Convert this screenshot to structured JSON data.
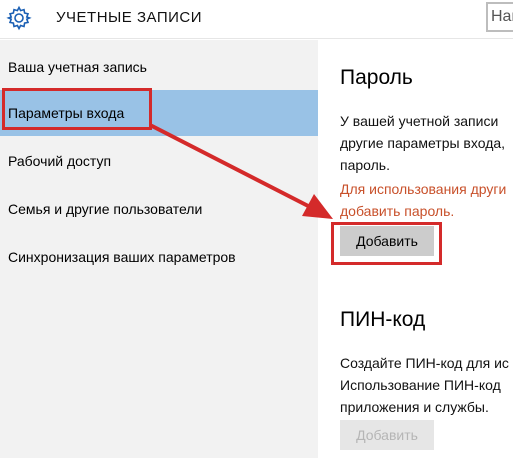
{
  "header": {
    "title": "УЧЕТНЫЕ ЗАПИСИ",
    "settings_icon": "gear-icon",
    "search_value": "Най"
  },
  "sidebar": {
    "items": [
      {
        "label": "Ваша учетная запись",
        "selected": false
      },
      {
        "label": "Параметры входа",
        "selected": true
      },
      {
        "label": "Рабочий доступ",
        "selected": false
      },
      {
        "label": "Семья и другие пользователи",
        "selected": false
      },
      {
        "label": "Синхронизация ваших параметров",
        "selected": false
      }
    ]
  },
  "password": {
    "title": "Пароль",
    "desc_lines": [
      "У вашей учетной записи",
      "другие параметры входа,",
      "пароль."
    ],
    "warning_lines": [
      "Для использования други",
      "добавить пароль."
    ],
    "add_label": "Добавить"
  },
  "pin": {
    "title": "ПИН-код",
    "desc_lines": [
      "Создайте ПИН-код для ис",
      "Использование ПИН-код",
      "приложения и службы."
    ],
    "add_label": "Добавить"
  },
  "colors": {
    "selection": "#99c2e6",
    "highlight": "#d42a2a",
    "warning": "#c8502a"
  }
}
